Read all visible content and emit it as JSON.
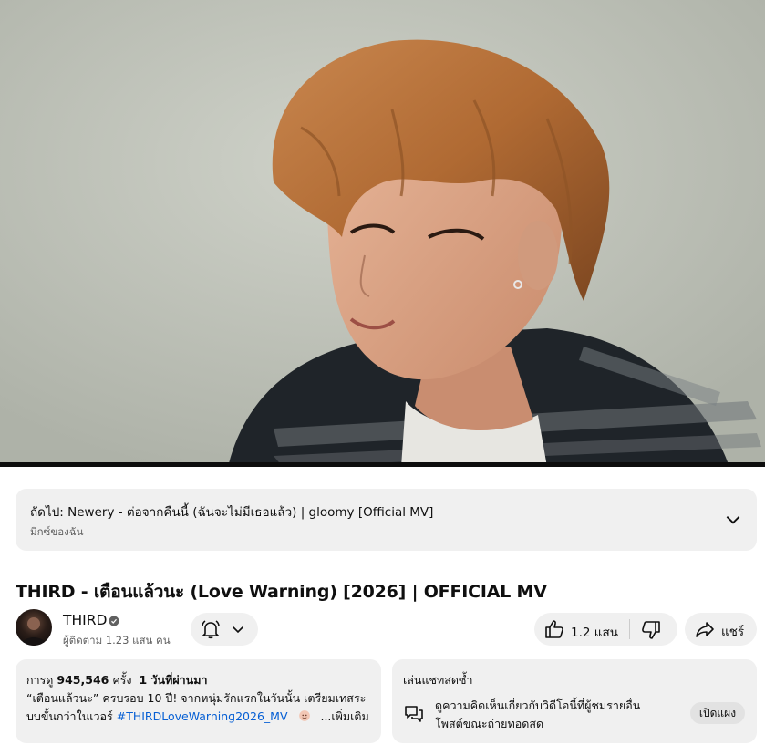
{
  "player": {
    "thumbnail_description": ""
  },
  "up_next": {
    "title": "ถัดไป: Newery - ต่อจากคืนนี้ (ฉันจะไม่มีเธอแล้ว) | gloomy [Official MV]",
    "subtitle": "มิกซ์ของฉัน",
    "expand_icon": "chevron-down-icon"
  },
  "video": {
    "title": "THIRD - เตือนแล้วนะ (Love Warning) [2026] | OFFICIAL MV"
  },
  "channel": {
    "name": "THIRD",
    "subscribers": "ผู้ติดตาม 1.23 แสน คน",
    "verified_icon": "verified-check-icon",
    "bell_icon": "bell-icon"
  },
  "actions": {
    "like_count": "1.2 แสน",
    "share_label": "แชร์"
  },
  "description": {
    "views_prefix": "การดู",
    "views": "945,546",
    "views_suffix": "ครั้ง",
    "date": "1 วันที่ผ่านมา",
    "line1": "“เตือนแล้วนะ” ครบรอบ 10 ปี! จากหนุ่มรักแรกในวันนั้น เตรียมเทสระ",
    "line2_prefix": "บบขั้นกว่าในเวอร์",
    "hashtag": "#THIRDLoveWarning2026_MV",
    "more": "...เพิ่มเติม"
  },
  "live_chat": {
    "title": "เล่นแชทสดซ้ำ",
    "text_line1": "ดูความคิดเห็นเกี่ยวกับวิดีโอนี้ที่ผู้ชมรายอื่น",
    "text_line2": "โพสต์ขณะถ่ายทอดสด",
    "button": "เปิดแผง"
  },
  "colors": {
    "link": "#065fd4",
    "pill_bg": "#f0f0f0",
    "secondary_text": "#606060"
  }
}
